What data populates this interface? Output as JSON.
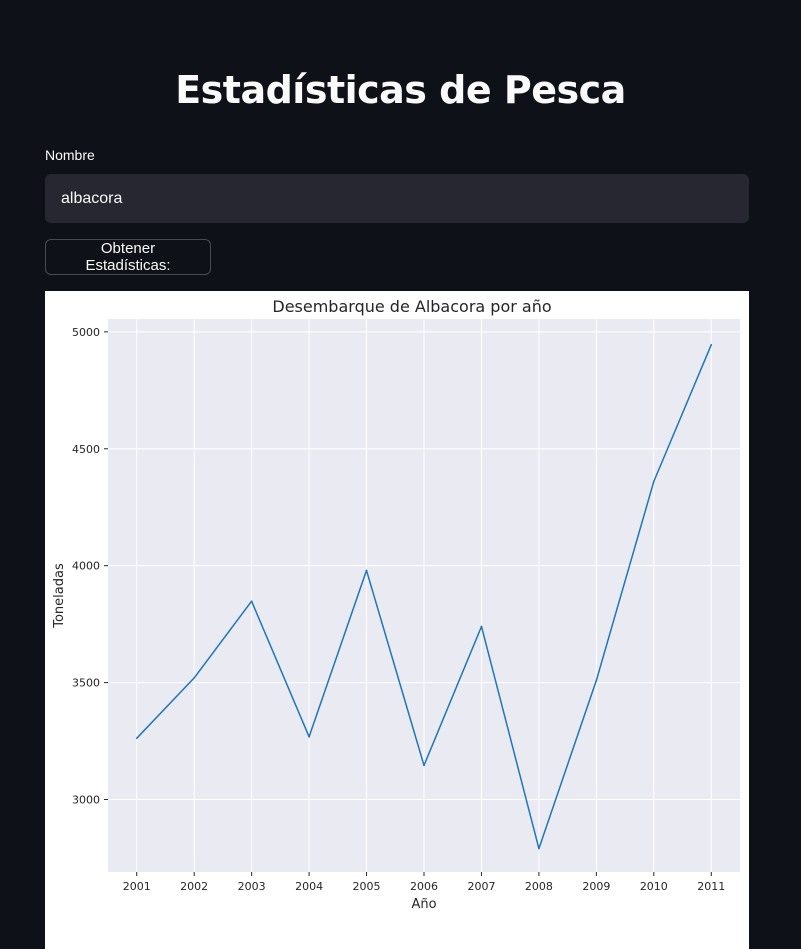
{
  "app": {
    "title": "Estadísticas de Pesca"
  },
  "form": {
    "name_label": "Nombre",
    "name_value": "albacora",
    "submit_label": "Obtener Estadísticas:"
  },
  "colors": {
    "background": "#0e1117",
    "input_bg": "#262730",
    "plot_bg": "#eaeaf2",
    "line": "#1f77b4"
  },
  "chart_data": {
    "type": "line",
    "title": "Desembarque de Albacora por año",
    "xlabel": "Año",
    "ylabel": "Toneladas",
    "x": [
      "2001",
      "2002",
      "2003",
      "2004",
      "2005",
      "2006",
      "2007",
      "2008",
      "2009",
      "2010",
      "2011"
    ],
    "values": [
      3262,
      3520,
      3848,
      3268,
      3980,
      3146,
      3740,
      2790,
      3510,
      4360,
      4945
    ],
    "yticks": [
      3000,
      3500,
      4000,
      4500,
      5000
    ],
    "ylim": [
      2690,
      5055
    ],
    "grid": true
  }
}
